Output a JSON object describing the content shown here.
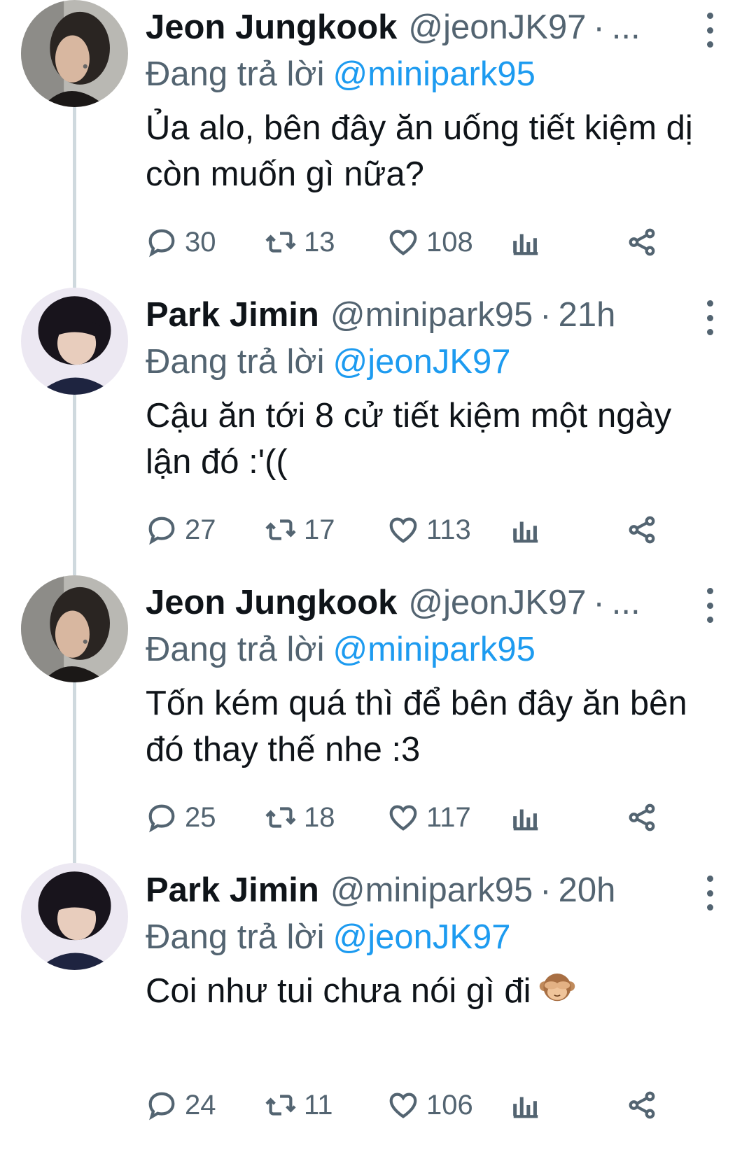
{
  "tweets": [
    {
      "name": "Jeon Jungkook",
      "handle": "@jeonJK97",
      "dot": "·",
      "time": "...",
      "reply_label": "Đang trả lời",
      "reply_to": "@minipark95",
      "text": "Ủa alo, bên đây ăn uống tiết kiệm dị còn muốn gì nữa?",
      "replies": "30",
      "retweets": "13",
      "likes": "108",
      "avatar": "jungkook"
    },
    {
      "name": "Park Jimin",
      "handle": "@minipark95",
      "dot": "·",
      "time": "21h",
      "reply_label": "Đang trả lời",
      "reply_to": "@jeonJK97",
      "text": "Cậu ăn tới 8 cử tiết kiệm một ngày lận đó :'((",
      "replies": "27",
      "retweets": "17",
      "likes": "113",
      "avatar": "jimin"
    },
    {
      "name": "Jeon Jungkook",
      "handle": "@jeonJK97",
      "dot": "·",
      "time": "...",
      "reply_label": "Đang trả lời",
      "reply_to": "@minipark95",
      "text": "Tốn kém quá thì để bên đây ăn bên đó thay thế nhe :3",
      "replies": "25",
      "retweets": "18",
      "likes": "117",
      "avatar": "jungkook"
    },
    {
      "name": "Park Jimin",
      "handle": "@minipark95",
      "dot": "·",
      "time": "20h",
      "reply_label": "Đang trả lời",
      "reply_to": "@jeonJK97",
      "text": "Coi như tui chưa nói gì đi",
      "emoji": "see-no-evil-monkey",
      "replies": "24",
      "retweets": "11",
      "likes": "106",
      "avatar": "jimin"
    }
  ],
  "colors": {
    "text": "#0f1419",
    "secondary": "#536471",
    "link": "#1d9bf0",
    "thread_line": "#cfd9de"
  },
  "icons": [
    "reply-icon",
    "retweet-icon",
    "like-icon",
    "views-icon",
    "share-icon",
    "more-options-icon"
  ]
}
